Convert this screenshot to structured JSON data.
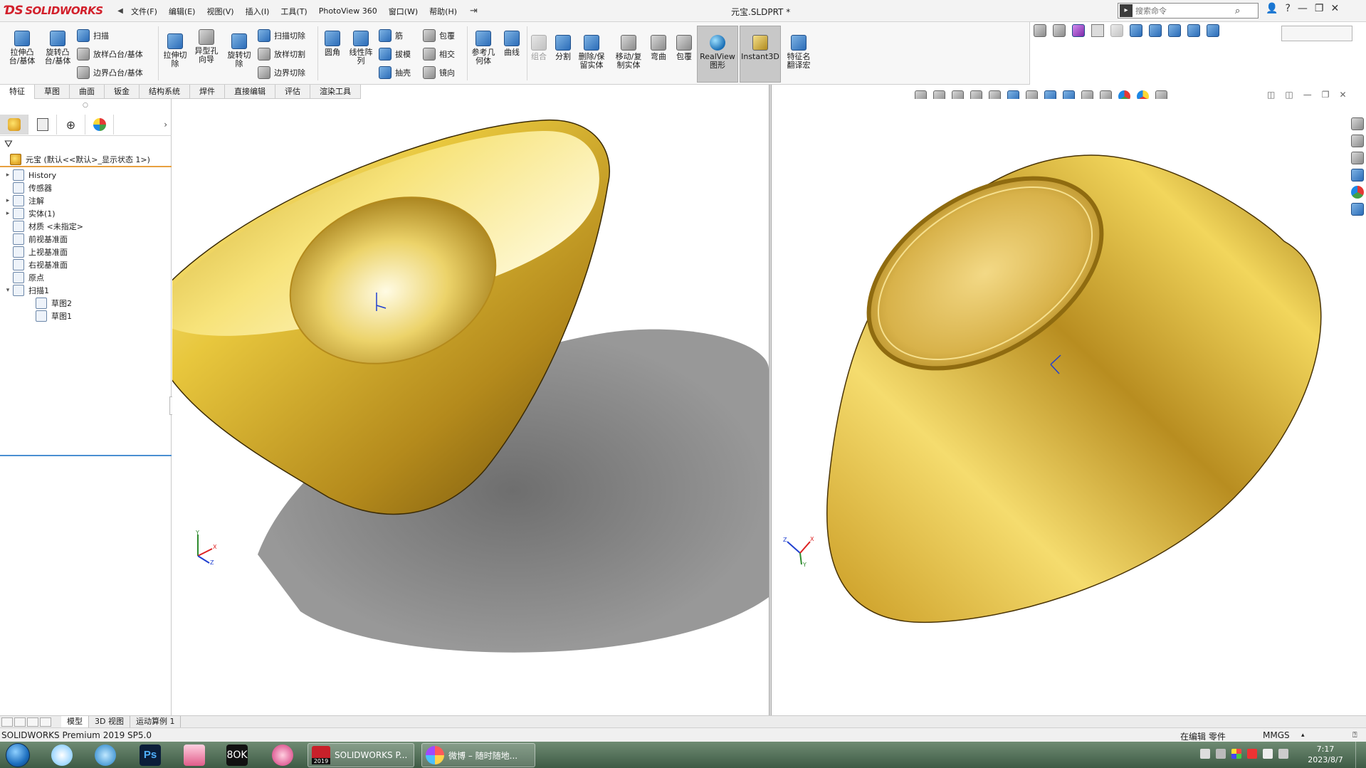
{
  "app": {
    "brand": "SOLIDWORKS",
    "doc_title": "元宝.SLDPRT *",
    "menu": [
      "文件(F)",
      "编辑(E)",
      "视图(V)",
      "插入(I)",
      "工具(T)",
      "PhotoView 360",
      "窗口(W)",
      "帮助(H)"
    ],
    "search_placeholder": "搜索命令"
  },
  "toolbar": {
    "extrude_boss": "拉伸凸\n台/基体",
    "revolve_boss": "旋转凸\n台/基体",
    "sweep": "扫描",
    "loft_boss": "放样凸台/基体",
    "boundary_boss": "边界凸台/基体",
    "extrude_cut": "拉伸切\n除",
    "hole_wizard": "异型孔\n向导",
    "revolve_cut": "旋转切\n除",
    "sweep_cut": "扫描切除",
    "loft_cut": "放样切割",
    "boundary_cut": "边界切除",
    "fillet": "圆角",
    "linear_pattern": "线性阵\n列",
    "rib": "筋",
    "draft": "拔模",
    "shell": "抽壳",
    "wrap": "包覆",
    "intersect": "相交",
    "mirror": "镜向",
    "ref_geometry": "参考几\n何体",
    "curves": "曲线",
    "combine": "组合",
    "split": "分割",
    "delete_keep_body": "删除/保\n留实体",
    "move_copy_body": "移动/复\n制实体",
    "flex": "弯曲",
    "wrap2": "包覆",
    "realview": "RealView\n图形",
    "instant3d": "Instant3D",
    "feature_name_translate": "特征名\n翻译宏"
  },
  "tabs": [
    "特征",
    "草图",
    "曲面",
    "钣金",
    "结构系统",
    "焊件",
    "直接编辑",
    "评估",
    "渲染工具"
  ],
  "feature_tree": {
    "root": "元宝  (默认<<默认>_显示状态 1>)",
    "items": [
      {
        "label": "History",
        "expand": "▸"
      },
      {
        "label": "传感器",
        "expand": ""
      },
      {
        "label": "注解",
        "expand": "▸"
      },
      {
        "label": "实体(1)",
        "expand": "▸"
      },
      {
        "label": "材质 <未指定>",
        "expand": ""
      },
      {
        "label": "前视基准面",
        "expand": ""
      },
      {
        "label": "上视基准面",
        "expand": ""
      },
      {
        "label": "右视基准面",
        "expand": ""
      },
      {
        "label": "原点",
        "expand": ""
      },
      {
        "label": "扫描1",
        "expand": "▾"
      },
      {
        "label": "草图2",
        "expand": ""
      },
      {
        "label": "草图1",
        "expand": ""
      }
    ]
  },
  "triad": {
    "x": "X",
    "y": "Y",
    "z": "Z"
  },
  "bottom_tabs": [
    "模型",
    "3D 视图",
    "运动算例 1"
  ],
  "status": {
    "product": "SOLIDWORKS Premium 2019 SP5.0",
    "mode": "在编辑 零件",
    "units": "MMGS",
    "units_arrow": "▴"
  },
  "taskbar": {
    "solidworks_task": "SOLIDWORKS P...",
    "solidworks_badge": "2019",
    "weibo_task": "微博 – 随时随地...",
    "time": "7:17",
    "date": "2023/8/7"
  },
  "colors": {
    "gold_light": "#fff3a8",
    "gold_mid": "#e3c23a",
    "gold_dark": "#8f6b10",
    "brand_red": "#d2202b",
    "accent_blue": "#4a8fd1"
  }
}
